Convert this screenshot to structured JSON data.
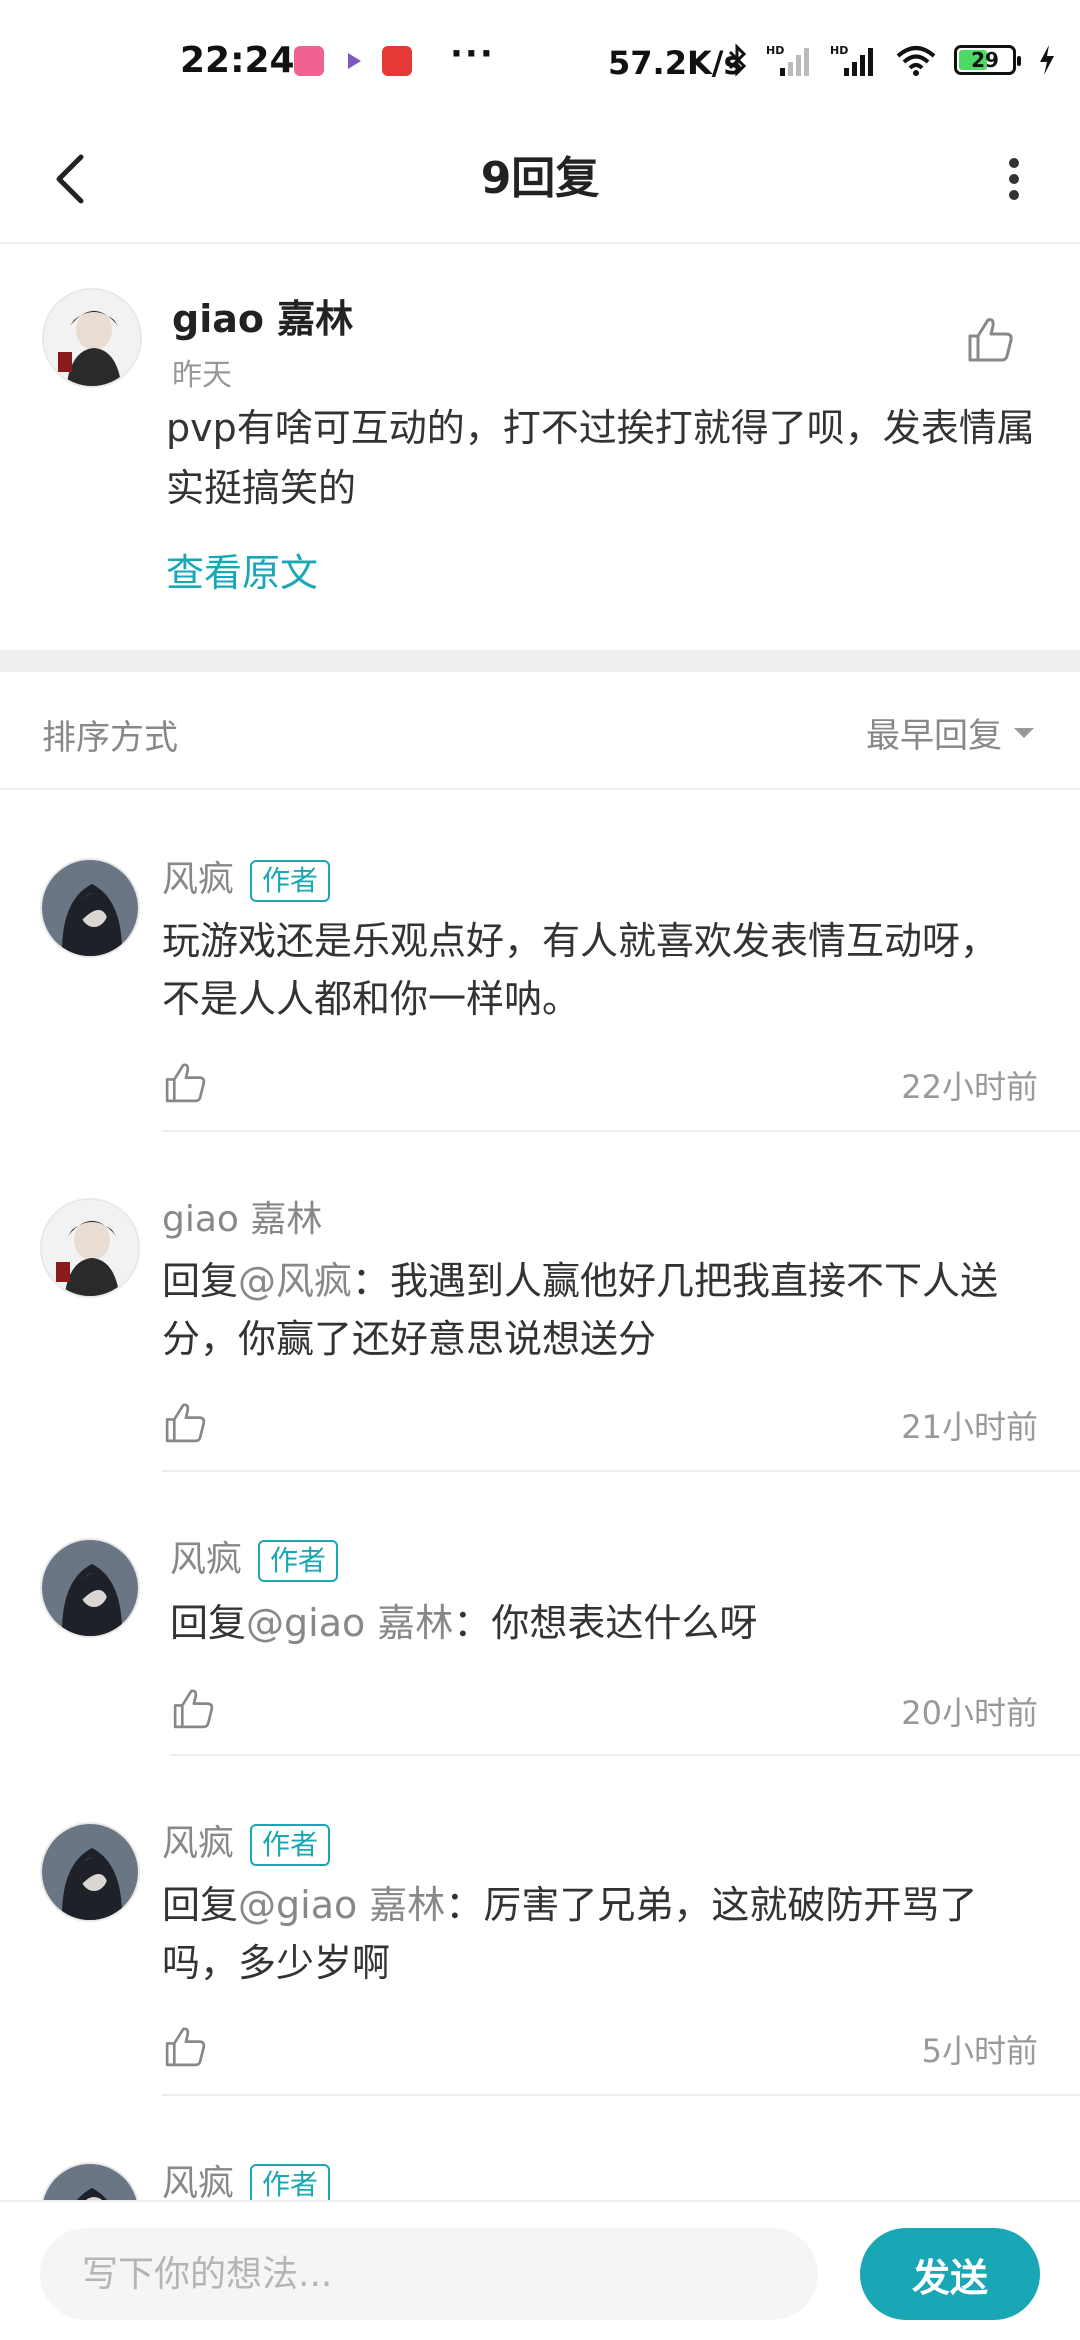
{
  "status_bar": {
    "time": "22:24",
    "net_speed": "57.2K/s",
    "battery_level": "29",
    "app_icon_colors": [
      "#f06292",
      "#e3f2fd",
      "#e53935"
    ],
    "icons": [
      "bilibili-icon",
      "video-play-icon",
      "red-app-icon",
      "bluetooth-icon",
      "hd-signal-icon",
      "hd-signal-icon",
      "wifi-icon",
      "battery-icon",
      "charging-icon"
    ]
  },
  "header": {
    "title": "9回复",
    "back_icon": "chevron-left-icon",
    "more_icon": "more-vertical-icon"
  },
  "original_post": {
    "author": "giao 嘉林",
    "time": "昨天",
    "text": "pvp有啥可互动的，打不过挨打就得了呗，发表情属实挺搞笑的",
    "view_original_label": "查看原文"
  },
  "sort": {
    "label": "排序方式",
    "value": "最早回复"
  },
  "replies": [
    {
      "author": "风疯",
      "badge": "作者",
      "prefix": "",
      "mention": "",
      "text": "玩游戏还是乐观点好，有人就喜欢发表情互动呀，不是人人都和你一样呐。",
      "time": "22小时前"
    },
    {
      "author": "giao 嘉林",
      "badge": "",
      "prefix": "回复",
      "mention": "@风疯",
      "text": "：我遇到人赢他好几把我直接不下人送分，你赢了还好意思说想送分",
      "time": "21小时前"
    },
    {
      "author": "风疯",
      "badge": "作者",
      "prefix": "回复",
      "mention": "@giao 嘉林",
      "text": "：你想表达什么呀",
      "time": "20小时前"
    },
    {
      "author": "风疯",
      "badge": "作者",
      "prefix": "回复",
      "mention": "@giao 嘉林",
      "text": "：厉害了兄弟，这就破防开骂了吗，多少岁啊",
      "time": "5小时前"
    },
    {
      "author": "风疯",
      "badge": "作者"
    }
  ],
  "composer": {
    "placeholder": "写下你的想法...",
    "send_label": "发送"
  },
  "colors": {
    "accent": "#1aa7b5",
    "muted_text": "#888888",
    "divider": "#eeeeee"
  }
}
